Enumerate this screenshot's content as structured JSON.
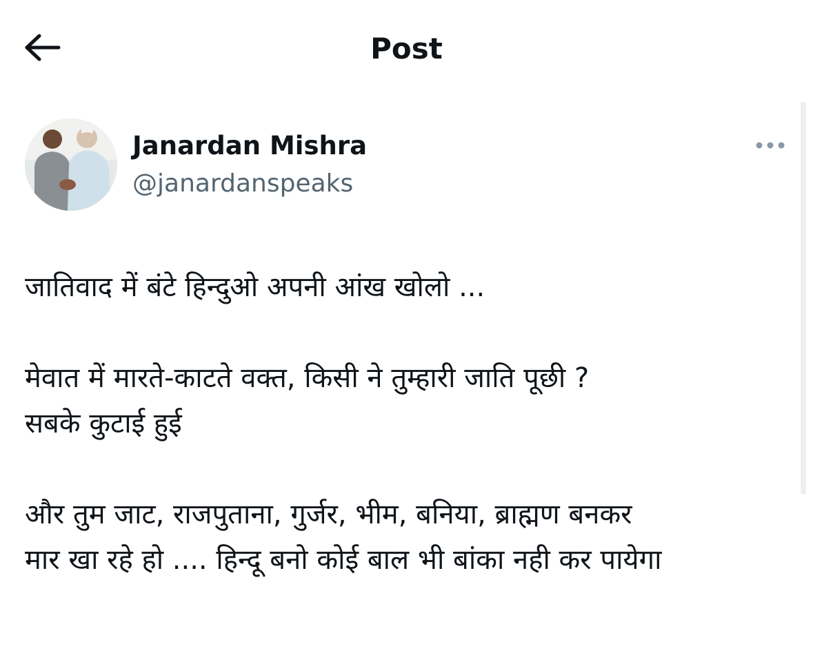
{
  "header": {
    "title": "Post",
    "back_icon": "arrow-left-icon"
  },
  "author": {
    "name": "Janardan Mishra",
    "handle": "@janardanspeaks",
    "avatar_icon": "profile-photo"
  },
  "more_icon": "more-horizontal-icon",
  "post": {
    "lines": [
      "जातिवाद में बंटे हिन्दुओ अपनी आंख खोलो ...",
      "मेवात में मारते-काटते वक्त, किसी ने तुम्हारी जाति पूछी ?",
      "सबके कुटाई हुई",
      "और तुम जाट, राजपुताना, गुर्जर, भीम, बनिया, ब्राह्मण बनकर",
      "मार खा रहे हो .... हिन्दू बनो कोई बाल भी बांका नही कर पायेगा"
    ]
  },
  "colors": {
    "text_primary": "#0f1419",
    "text_secondary": "#536471",
    "background": "#ffffff",
    "scrollbar": "#eceef0"
  }
}
